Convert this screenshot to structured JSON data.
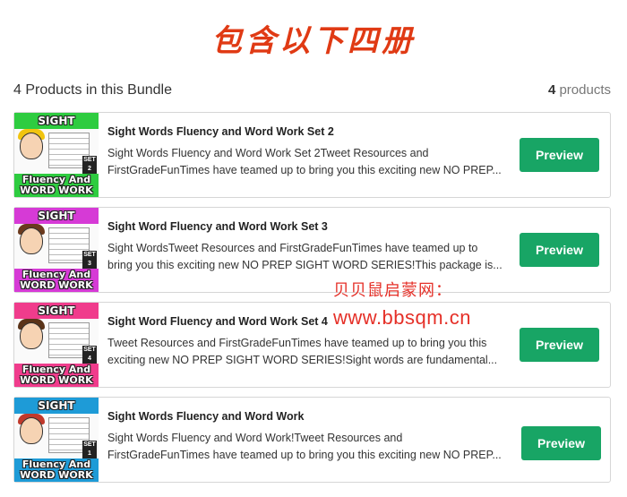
{
  "banner": {
    "text": "包含以下四册"
  },
  "bundle": {
    "title": "4 Products in this Bundle",
    "count_number": "4",
    "count_label": "products"
  },
  "products": [
    {
      "title": "Sight Words Fluency and Word Work Set 2",
      "desc_line1": "Sight Words Fluency and Word Work Set 2Tweet Resources and",
      "desc_line2": "FirstGradeFunTimes have teamed up to bring you this exciting new NO PREP...",
      "preview_label": "Preview",
      "thumb_top": "SIGHT WORDS",
      "thumb_bottom_1": "Fluency And",
      "thumb_bottom_2": "WORD WORK",
      "set_tag": "SET 2",
      "theme_color": "#2ecc40",
      "hair_color": "#f1c40f"
    },
    {
      "title": "Sight Word Fluency and Word Work Set 3",
      "desc_line1": "Sight WordsTweet Resources and FirstGradeFunTimes have teamed up to",
      "desc_line2": "bring you this exciting new NO PREP SIGHT WORD SERIES!This package is...",
      "preview_label": "Preview",
      "thumb_top": "SIGHT WORDS",
      "thumb_bottom_1": "Fluency And",
      "thumb_bottom_2": "WORD WORK",
      "set_tag": "SET 3",
      "theme_color": "#d63ad6",
      "hair_color": "#6b3a1e"
    },
    {
      "title": "Sight Word Fluency and Word Work Set 4",
      "desc_line1": "Tweet Resources and FirstGradeFunTimes have teamed up to bring you this",
      "desc_line2": "exciting new NO PREP SIGHT WORD SERIES!Sight words are fundamental...",
      "preview_label": "Preview",
      "thumb_top": "SIGHT WORDS",
      "thumb_bottom_1": "Fluency And",
      "thumb_bottom_2": "WORD WORK",
      "set_tag": "SET 4",
      "theme_color": "#f03c8c",
      "hair_color": "#5a3318"
    },
    {
      "title": "Sight Words Fluency and Word Work",
      "desc_line1": "Sight Words Fluency and Word Work!Tweet Resources and",
      "desc_line2": "FirstGradeFunTimes have teamed up to bring you this exciting new NO PREP...",
      "preview_label": "Preview",
      "thumb_top": "SIGHT WORDS",
      "thumb_bottom_1": "Fluency And",
      "thumb_bottom_2": "WORD WORK",
      "set_tag": "SET 1",
      "theme_color": "#1e9bd7",
      "hair_color": "#c0392b"
    }
  ],
  "watermark": {
    "line1": "贝贝鼠启蒙网：",
    "line2": "www.bbsqm.cn"
  },
  "colors": {
    "accent_green": "#18a565",
    "banner_red": "#e03a14",
    "watermark_red": "#e53028"
  }
}
